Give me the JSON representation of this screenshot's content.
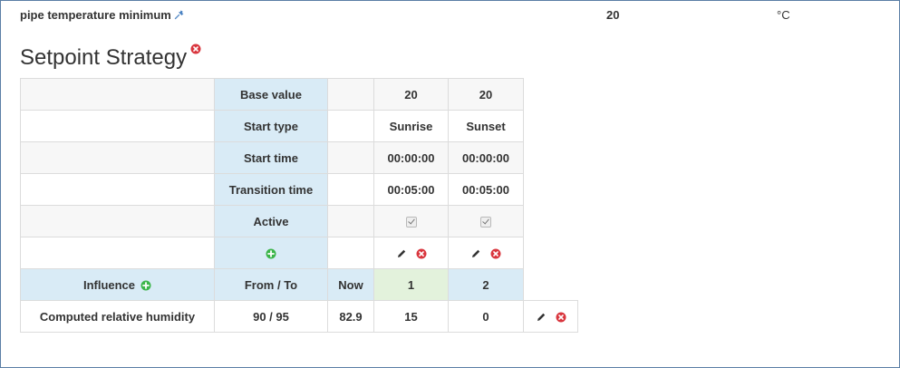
{
  "parameter": {
    "label": "pipe temperature minimum",
    "value": "20",
    "unit": "°C",
    "pin_icon": "pin-icon"
  },
  "section": {
    "title": "Setpoint Strategy",
    "remove_icon": "remove-circle-icon"
  },
  "schedule": {
    "rows": [
      {
        "label": "Base value",
        "periods": [
          "20",
          "20"
        ]
      },
      {
        "label": "Start type",
        "periods": [
          "Sunrise",
          "Sunset"
        ]
      },
      {
        "label": "Start time",
        "periods": [
          "00:00:00",
          "00:00:00"
        ]
      },
      {
        "label": "Transition time",
        "periods": [
          "00:05:00",
          "00:05:00"
        ]
      },
      {
        "label": "Active",
        "periods": [
          true,
          true
        ]
      }
    ],
    "add_period_icon": "add-circle-icon",
    "edit_icon": "pencil-icon",
    "remove_icon": "remove-circle-icon"
  },
  "influence": {
    "header": {
      "label": "Influence",
      "from_to": "From / To",
      "now": "Now",
      "periods": [
        "1",
        "2"
      ]
    },
    "rows": [
      {
        "name": "Computed relative humidity",
        "from_to": "90 / 95",
        "now": "82.9",
        "values": [
          "15",
          "0"
        ]
      }
    ]
  },
  "colors": {
    "header_blue": "#d9ebf6",
    "current_period_green": "#e3f2dc",
    "add_green": "#3cb54a",
    "remove_red": "#d9363e",
    "frame_border": "#5b7fa6"
  }
}
